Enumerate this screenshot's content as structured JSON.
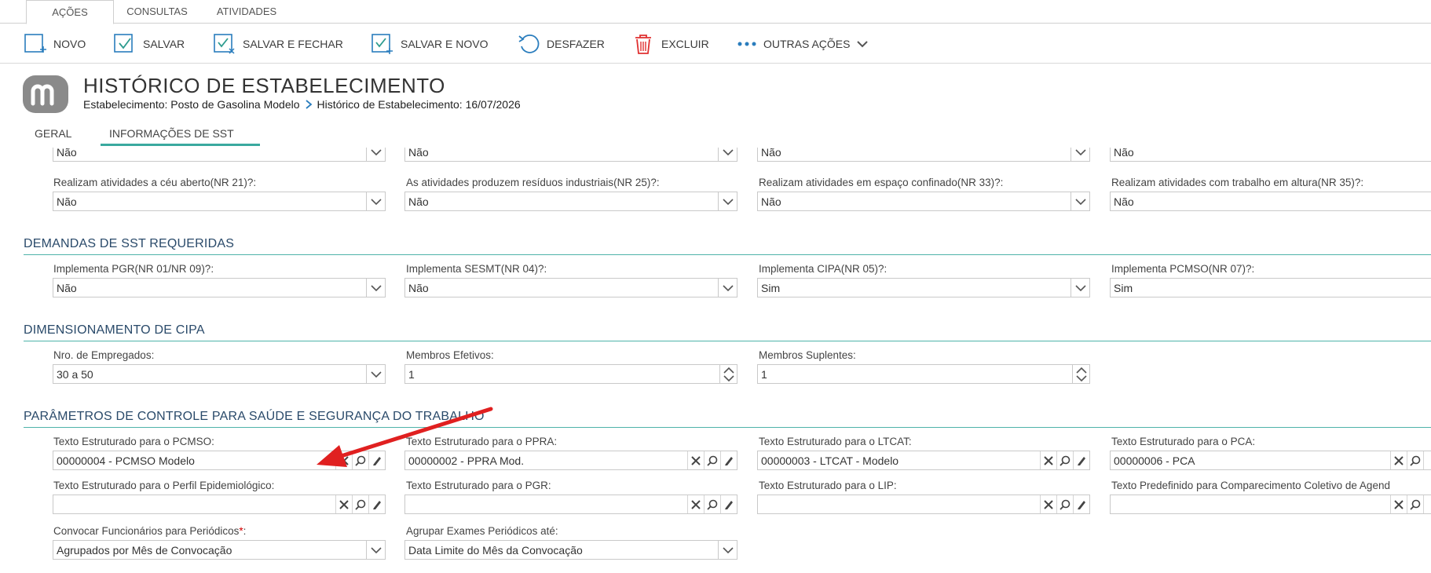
{
  "menu_tabs": [
    "AÇÕES",
    "CONSULTAS",
    "ATIVIDADES"
  ],
  "toolbar": {
    "novo": "NOVO",
    "salvar": "SALVAR",
    "salvar_fechar": "SALVAR E FECHAR",
    "salvar_novo": "SALVAR E NOVO",
    "desfazer": "DESFAZER",
    "excluir": "EXCLUIR",
    "outras": "OUTRAS AÇÕES"
  },
  "header": {
    "title": "HISTÓRICO DE ESTABELECIMENTO",
    "crumb1": "Estabelecimento: Posto de Gasolina Modelo",
    "crumb2": "Histórico de Estabelecimento: 16/07/2026"
  },
  "form_tabs": [
    "GERAL",
    "INFORMAÇÕES DE SST"
  ],
  "top_row": {
    "v1": "Não",
    "v2": "Não",
    "v3": "Não",
    "v4": "Não"
  },
  "atividades": {
    "f1": {
      "label": "Realizam atividades a céu aberto(NR 21)?:",
      "value": "Não"
    },
    "f2": {
      "label": "As atividades produzem resíduos industriais(NR 25)?:",
      "value": "Não"
    },
    "f3": {
      "label": "Realizam atividades em espaço confinado(NR 33)?:",
      "value": "Não"
    },
    "f4": {
      "label": "Realizam atividades com trabalho em altura(NR 35)?:",
      "value": "Não"
    }
  },
  "demandas": {
    "title": "DEMANDAS DE SST REQUERIDAS",
    "f1": {
      "label": "Implementa PGR(NR 01/NR 09)?:",
      "value": "Não"
    },
    "f2": {
      "label": "Implementa SESMT(NR 04)?:",
      "value": "Não"
    },
    "f3": {
      "label": "Implementa CIPA(NR 05)?:",
      "value": "Sim"
    },
    "f4": {
      "label": "Implementa PCMSO(NR 07)?:",
      "value": "Sim"
    }
  },
  "cipa": {
    "title": "DIMENSIONAMENTO DE CIPA",
    "f1": {
      "label": "Nro. de Empregados:",
      "value": "30 a 50"
    },
    "f2": {
      "label": "Membros Efetivos:",
      "value": "1"
    },
    "f3": {
      "label": "Membros Suplentes:",
      "value": "1"
    }
  },
  "parametros": {
    "title": "PARÂMETROS DE CONTROLE PARA SAÚDE E SEGURANÇA DO TRABALHO",
    "pcmso": {
      "label": "Texto Estruturado para o PCMSO:",
      "value": "00000004 - PCMSO Modelo"
    },
    "ppra": {
      "label": "Texto Estruturado para o PPRA:",
      "value": "00000002 - PPRA Mod."
    },
    "ltcat": {
      "label": "Texto Estruturado para o LTCAT:",
      "value": "00000003 - LTCAT  - Modelo"
    },
    "pca": {
      "label": "Texto Estruturado para o PCA:",
      "value": "00000006 - PCA"
    },
    "perfil": {
      "label": "Texto Estruturado para o Perfil Epidemiológico:",
      "value": ""
    },
    "pgr": {
      "label": "Texto Estruturado para o PGR:",
      "value": ""
    },
    "lip": {
      "label": "Texto Estruturado para o LIP:",
      "value": ""
    },
    "agenda": {
      "label": "Texto Predefinido para Comparecimento Coletivo de Agend",
      "value": ""
    },
    "convocar": {
      "label": "Convocar Funcionários para Periódicos",
      "required_mark": "*",
      "label_suffix": ":",
      "value": "Agrupados por Mês de Convocação"
    },
    "agrupar": {
      "label": "Agrupar Exames Periódicos até:",
      "value": "Data Limite do Mês da Convocação"
    }
  },
  "colors": {
    "accent": "#2a7dbd",
    "section_line": "#4fb3a9",
    "annotation_arrow": "#e02020",
    "icon_teal": "#2e9c8f"
  }
}
